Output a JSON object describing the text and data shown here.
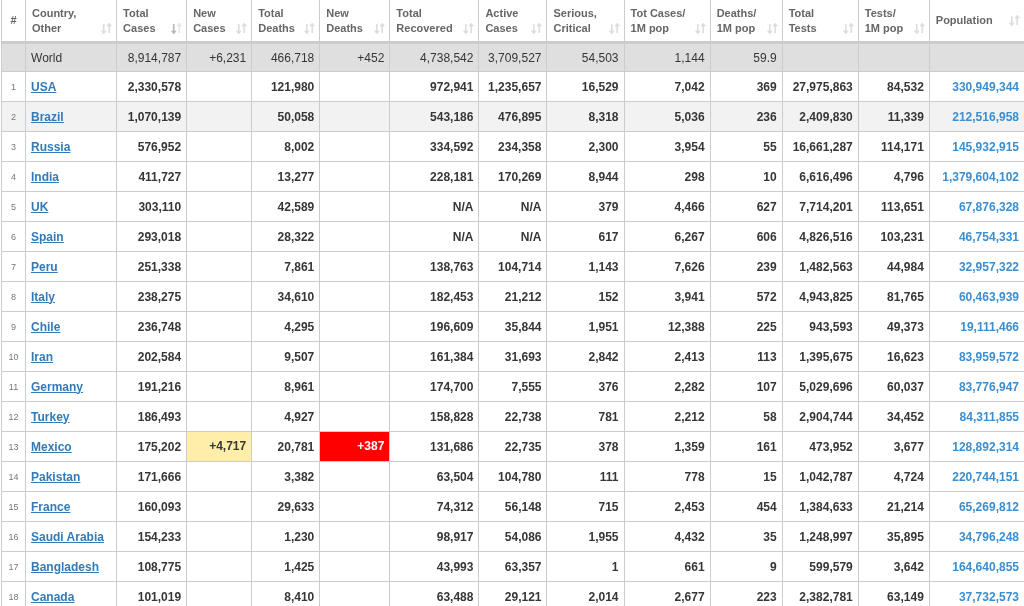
{
  "table": {
    "columns": [
      {
        "label": "#",
        "kind": "rank"
      },
      {
        "label": "Country,\nOther",
        "kind": "country",
        "sorted": false
      },
      {
        "label": "Total\nCases",
        "kind": "number",
        "sorted": true
      },
      {
        "label": "New\nCases",
        "kind": "new_cases",
        "sorted": false
      },
      {
        "label": "Total\nDeaths",
        "kind": "number",
        "sorted": false
      },
      {
        "label": "New\nDeaths",
        "kind": "new_deaths",
        "sorted": false
      },
      {
        "label": "Total\nRecovered",
        "kind": "number",
        "sorted": false
      },
      {
        "label": "Active\nCases",
        "kind": "number",
        "sorted": false
      },
      {
        "label": "Serious,\nCritical",
        "kind": "number",
        "sorted": false
      },
      {
        "label": "Tot Cases/\n1M pop",
        "kind": "number",
        "sorted": false
      },
      {
        "label": "Deaths/\n1M pop",
        "kind": "number",
        "sorted": false
      },
      {
        "label": "Total\nTests",
        "kind": "number",
        "sorted": false
      },
      {
        "label": "Tests/\n1M pop",
        "kind": "number",
        "sorted": false
      },
      {
        "label": "Population",
        "kind": "population",
        "sorted": false
      }
    ],
    "rows": [
      {
        "kind": "total",
        "country": "World",
        "total_cases": "8,914,787",
        "new_cases": "+6,231",
        "total_deaths": "466,718",
        "new_deaths": "+452",
        "total_recovered": "4,738,542",
        "active_cases": "3,709,527",
        "serious_critical": "54,503",
        "cases_per_1m": "1,144",
        "deaths_per_1m": "59.9"
      },
      {
        "kind": "country",
        "highlighted": false,
        "rank": "1",
        "country": "USA",
        "total_cases": "2,330,578",
        "total_deaths": "121,980",
        "total_recovered": "972,941",
        "active_cases": "1,235,657",
        "serious_critical": "16,529",
        "cases_per_1m": "7,042",
        "deaths_per_1m": "369",
        "total_tests": "27,975,863",
        "tests_per_1m": "84,532",
        "population": "330,949,344"
      },
      {
        "kind": "country",
        "highlighted": true,
        "rank": "2",
        "country": "Brazil",
        "total_cases": "1,070,139",
        "total_deaths": "50,058",
        "total_recovered": "543,186",
        "active_cases": "476,895",
        "serious_critical": "8,318",
        "cases_per_1m": "5,036",
        "deaths_per_1m": "236",
        "total_tests": "2,409,830",
        "tests_per_1m": "11,339",
        "population": "212,516,958"
      },
      {
        "kind": "country",
        "highlighted": false,
        "rank": "3",
        "country": "Russia",
        "total_cases": "576,952",
        "total_deaths": "8,002",
        "total_recovered": "334,592",
        "active_cases": "234,358",
        "serious_critical": "2,300",
        "cases_per_1m": "3,954",
        "deaths_per_1m": "55",
        "total_tests": "16,661,287",
        "tests_per_1m": "114,171",
        "population": "145,932,915"
      },
      {
        "kind": "country",
        "highlighted": false,
        "rank": "4",
        "country": "India",
        "total_cases": "411,727",
        "total_deaths": "13,277",
        "total_recovered": "228,181",
        "active_cases": "170,269",
        "serious_critical": "8,944",
        "cases_per_1m": "298",
        "deaths_per_1m": "10",
        "total_tests": "6,616,496",
        "tests_per_1m": "4,796",
        "population": "1,379,604,102"
      },
      {
        "kind": "country",
        "highlighted": false,
        "rank": "5",
        "country": "UK",
        "total_cases": "303,110",
        "total_deaths": "42,589",
        "total_recovered": "N/A",
        "active_cases": "N/A",
        "serious_critical": "379",
        "cases_per_1m": "4,466",
        "deaths_per_1m": "627",
        "total_tests": "7,714,201",
        "tests_per_1m": "113,651",
        "population": "67,876,328"
      },
      {
        "kind": "country",
        "highlighted": false,
        "rank": "6",
        "country": "Spain",
        "total_cases": "293,018",
        "total_deaths": "28,322",
        "total_recovered": "N/A",
        "active_cases": "N/A",
        "serious_critical": "617",
        "cases_per_1m": "6,267",
        "deaths_per_1m": "606",
        "total_tests": "4,826,516",
        "tests_per_1m": "103,231",
        "population": "46,754,331"
      },
      {
        "kind": "country",
        "highlighted": false,
        "rank": "7",
        "country": "Peru",
        "total_cases": "251,338",
        "total_deaths": "7,861",
        "total_recovered": "138,763",
        "active_cases": "104,714",
        "serious_critical": "1,143",
        "cases_per_1m": "7,626",
        "deaths_per_1m": "239",
        "total_tests": "1,482,563",
        "tests_per_1m": "44,984",
        "population": "32,957,322"
      },
      {
        "kind": "country",
        "highlighted": false,
        "rank": "8",
        "country": "Italy",
        "total_cases": "238,275",
        "total_deaths": "34,610",
        "total_recovered": "182,453",
        "active_cases": "21,212",
        "serious_critical": "152",
        "cases_per_1m": "3,941",
        "deaths_per_1m": "572",
        "total_tests": "4,943,825",
        "tests_per_1m": "81,765",
        "population": "60,463,939"
      },
      {
        "kind": "country",
        "highlighted": false,
        "rank": "9",
        "country": "Chile",
        "total_cases": "236,748",
        "total_deaths": "4,295",
        "total_recovered": "196,609",
        "active_cases": "35,844",
        "serious_critical": "1,951",
        "cases_per_1m": "12,388",
        "deaths_per_1m": "225",
        "total_tests": "943,593",
        "tests_per_1m": "49,373",
        "population": "19,111,466"
      },
      {
        "kind": "country",
        "highlighted": false,
        "rank": "10",
        "country": "Iran",
        "total_cases": "202,584",
        "total_deaths": "9,507",
        "total_recovered": "161,384",
        "active_cases": "31,693",
        "serious_critical": "2,842",
        "cases_per_1m": "2,413",
        "deaths_per_1m": "113",
        "total_tests": "1,395,675",
        "tests_per_1m": "16,623",
        "population": "83,959,572"
      },
      {
        "kind": "country",
        "highlighted": false,
        "rank": "11",
        "country": "Germany",
        "total_cases": "191,216",
        "total_deaths": "8,961",
        "total_recovered": "174,700",
        "active_cases": "7,555",
        "serious_critical": "376",
        "cases_per_1m": "2,282",
        "deaths_per_1m": "107",
        "total_tests": "5,029,696",
        "tests_per_1m": "60,037",
        "population": "83,776,947"
      },
      {
        "kind": "country",
        "highlighted": false,
        "rank": "12",
        "country": "Turkey",
        "total_cases": "186,493",
        "total_deaths": "4,927",
        "total_recovered": "158,828",
        "active_cases": "22,738",
        "serious_critical": "781",
        "cases_per_1m": "2,212",
        "deaths_per_1m": "58",
        "total_tests": "2,904,744",
        "tests_per_1m": "34,452",
        "population": "84,311,855"
      },
      {
        "kind": "country",
        "highlighted": false,
        "rank": "13",
        "country": "Mexico",
        "total_cases": "175,202",
        "new_cases": "+4,717",
        "total_deaths": "20,781",
        "new_deaths": "+387",
        "total_recovered": "131,686",
        "active_cases": "22,735",
        "serious_critical": "378",
        "cases_per_1m": "1,359",
        "deaths_per_1m": "161",
        "total_tests": "473,952",
        "tests_per_1m": "3,677",
        "population": "128,892,314"
      },
      {
        "kind": "country",
        "highlighted": false,
        "rank": "14",
        "country": "Pakistan",
        "total_cases": "171,666",
        "total_deaths": "3,382",
        "total_recovered": "63,504",
        "active_cases": "104,780",
        "serious_critical": "111",
        "cases_per_1m": "778",
        "deaths_per_1m": "15",
        "total_tests": "1,042,787",
        "tests_per_1m": "4,724",
        "population": "220,744,151"
      },
      {
        "kind": "country",
        "highlighted": false,
        "rank": "15",
        "country": "France",
        "total_cases": "160,093",
        "total_deaths": "29,633",
        "total_recovered": "74,312",
        "active_cases": "56,148",
        "serious_critical": "715",
        "cases_per_1m": "2,453",
        "deaths_per_1m": "454",
        "total_tests": "1,384,633",
        "tests_per_1m": "21,214",
        "population": "65,269,812"
      },
      {
        "kind": "country",
        "highlighted": false,
        "rank": "16",
        "country": "Saudi Arabia",
        "total_cases": "154,233",
        "total_deaths": "1,230",
        "total_recovered": "98,917",
        "active_cases": "54,086",
        "serious_critical": "1,955",
        "cases_per_1m": "4,432",
        "deaths_per_1m": "35",
        "total_tests": "1,248,997",
        "tests_per_1m": "35,895",
        "population": "34,796,248"
      },
      {
        "kind": "country",
        "highlighted": false,
        "rank": "17",
        "country": "Bangladesh",
        "total_cases": "108,775",
        "total_deaths": "1,425",
        "total_recovered": "43,993",
        "active_cases": "63,357",
        "serious_critical": "1",
        "cases_per_1m": "661",
        "deaths_per_1m": "9",
        "total_tests": "599,579",
        "tests_per_1m": "3,642",
        "population": "164,640,855"
      },
      {
        "kind": "country",
        "highlighted": false,
        "rank": "18",
        "country": "Canada",
        "total_cases": "101,019",
        "total_deaths": "8,410",
        "total_recovered": "63,488",
        "active_cases": "29,121",
        "serious_critical": "2,014",
        "cases_per_1m": "2,677",
        "deaths_per_1m": "223",
        "total_tests": "2,382,781",
        "tests_per_1m": "63,149",
        "population": "37,732,573"
      }
    ]
  }
}
